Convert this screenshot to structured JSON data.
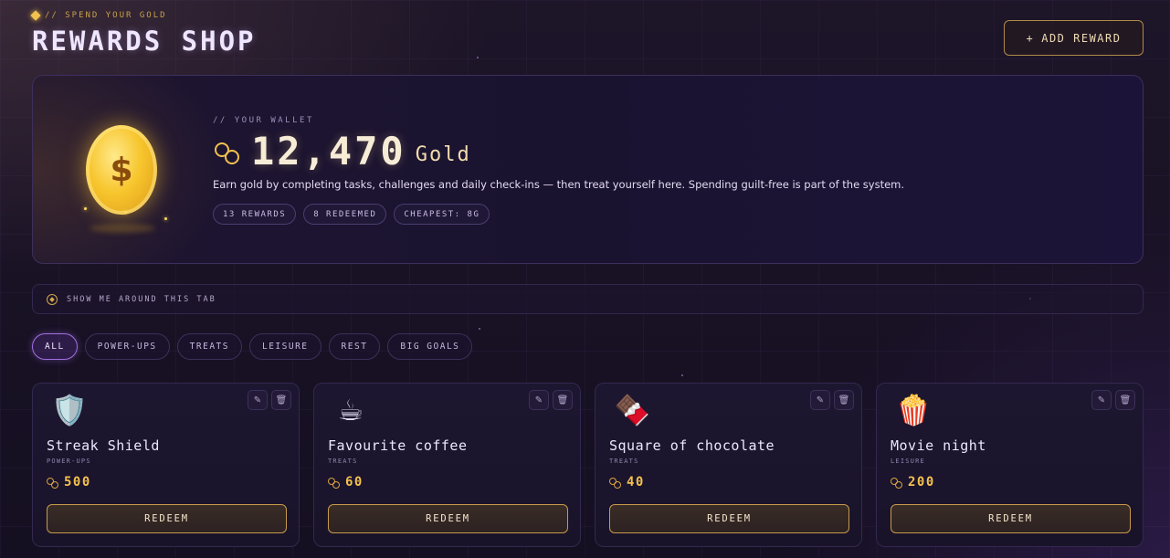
{
  "header": {
    "eyebrow": "// SPEND YOUR GOLD",
    "title": "REWARDS SHOP",
    "add_button_icon": "plus-icon",
    "add_button_label": "ADD REWARD"
  },
  "wallet": {
    "label": "// YOUR WALLET",
    "balance": "12,470",
    "unit": "Gold",
    "coin_symbol": "$",
    "description": "Earn gold by completing tasks, challenges and daily check-ins — then treat yourself here. Spending guilt-free is part of the system.",
    "chips": [
      "13 REWARDS",
      "8 REDEEMED",
      "CHEAPEST: 8G"
    ]
  },
  "tour": {
    "icon": "compass-icon",
    "label": "SHOW ME AROUND THIS TAB"
  },
  "filters": {
    "active": "ALL",
    "items": [
      "ALL",
      "POWER-UPS",
      "TREATS",
      "LEISURE",
      "REST",
      "BIG GOALS"
    ]
  },
  "cards": [
    {
      "icon": "shield-icon",
      "glyph": "🛡️",
      "title": "Streak Shield",
      "category": "POWER-UPS",
      "price": "500",
      "action": "REDEEM"
    },
    {
      "icon": "coffee-icon",
      "glyph": "☕",
      "title": "Favourite coffee",
      "category": "TREATS",
      "price": "60",
      "action": "REDEEM"
    },
    {
      "icon": "chocolate-icon",
      "glyph": "🍫",
      "title": "Square of chocolate",
      "category": "TREATS",
      "price": "40",
      "action": "REDEEM"
    },
    {
      "icon": "popcorn-icon",
      "glyph": "🍿",
      "title": "Movie night",
      "category": "LEISURE",
      "price": "200",
      "action": "REDEEM"
    }
  ],
  "colors": {
    "gold": "#f2c14e",
    "accent": "#a06fe0",
    "background": "#150f22"
  }
}
